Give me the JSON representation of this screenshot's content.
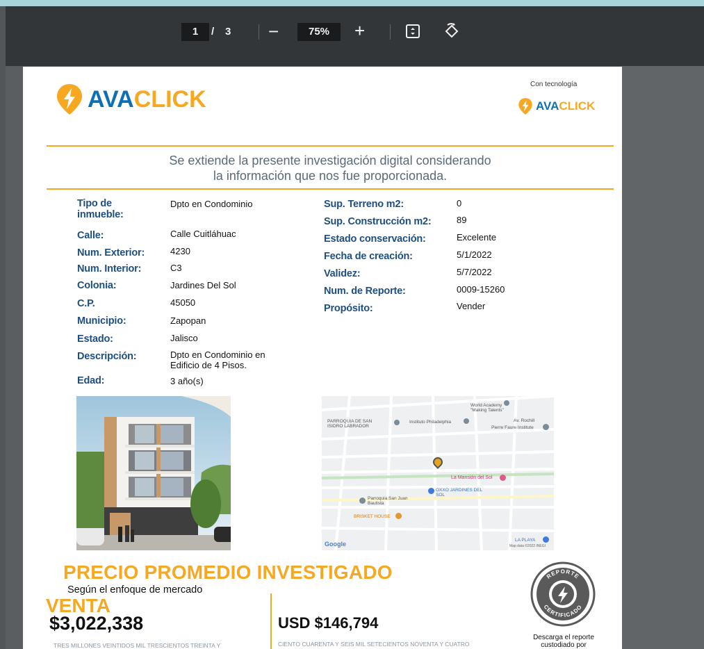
{
  "viewer": {
    "current_page": "1",
    "separator": "/",
    "total_pages": "3",
    "zoom": "75%",
    "zoom_out_label": "−",
    "zoom_in_label": "+",
    "fit_icon": "fit-page-icon",
    "rotate_icon": "rotate-icon"
  },
  "header": {
    "logo_part1": "AVA",
    "logo_part2": "CLICK",
    "tech_label": "Con tecnología",
    "brand_blue": "#0f6fb6",
    "brand_orange": "#f7a823"
  },
  "intro": {
    "line1": "Se extiende la presente investigación digital considerando",
    "line2": "la información que nos fue proporcionada."
  },
  "property_left": [
    {
      "label": "Tipo de inmueble:",
      "value": "Dpto en Condominio"
    },
    {
      "label": "Calle:",
      "value": "Calle Cuitláhuac"
    },
    {
      "label": "Num. Exterior:",
      "value": "4230"
    },
    {
      "label": "Num. Interior:",
      "value": "C3"
    },
    {
      "label": "Colonia:",
      "value": "Jardines Del Sol"
    },
    {
      "label": "C.P.",
      "value": "45050"
    },
    {
      "label": "Municipio:",
      "value": "Zapopan"
    },
    {
      "label": "Estado:",
      "value": "Jalisco"
    },
    {
      "label": "Descripción:",
      "value": "Dpto en Condominio en Edificio de  4 Pisos."
    },
    {
      "label": "Edad:",
      "value": "3 año(s)"
    }
  ],
  "property_right": [
    {
      "label": "Sup. Terreno m2:",
      "value": "0"
    },
    {
      "label": "Sup. Construcción m2:",
      "value": "89"
    },
    {
      "label": "Estado conservación:",
      "value": "Excelente"
    },
    {
      "label": "Fecha de creación:",
      "value": "5/1/2022"
    },
    {
      "label": "Validez:",
      "value": "5/7/2022"
    },
    {
      "label": "Num. de Reporte:",
      "value": "0009-15260"
    },
    {
      "label": "Propósito:",
      "value": "Vender"
    }
  ],
  "map": {
    "labels": [
      "World Academy \"Making Talents\"",
      "PARROQUIA DE SAN ISIDRO LABRADOR",
      "Instituto Philadelphia",
      "Av. Rochill",
      "Pierre Faure Institute",
      "La Mansión del Sol",
      "OXXO JARDINES DEL SOL",
      "Parroquia San Juan Bautista",
      "BRISKET HOUSE",
      "LA PLAYA"
    ],
    "google": "Google",
    "credit": "Map data ©2022 INEGI"
  },
  "pricing": {
    "heading": "PRECIO PROMEDIO INVESTIGADO",
    "subheading": "Según el enfoque de mercado",
    "type": "VENTA",
    "mxn_amount": "$3,022,338",
    "mxn_words": "TRES MILLONES VEINTIDOS MIL TRESCIENTOS TREINTA Y",
    "usd_amount": "USD $146,794",
    "usd_words": "CIENTO CUARENTA Y SEIS MIL SETECIENTOS NOVENTA Y CUATRO"
  },
  "seal": {
    "top_text": "REPORTE",
    "bottom_text": "CERTIFICADO",
    "caption": "Descarga el reporte custodiado por"
  }
}
